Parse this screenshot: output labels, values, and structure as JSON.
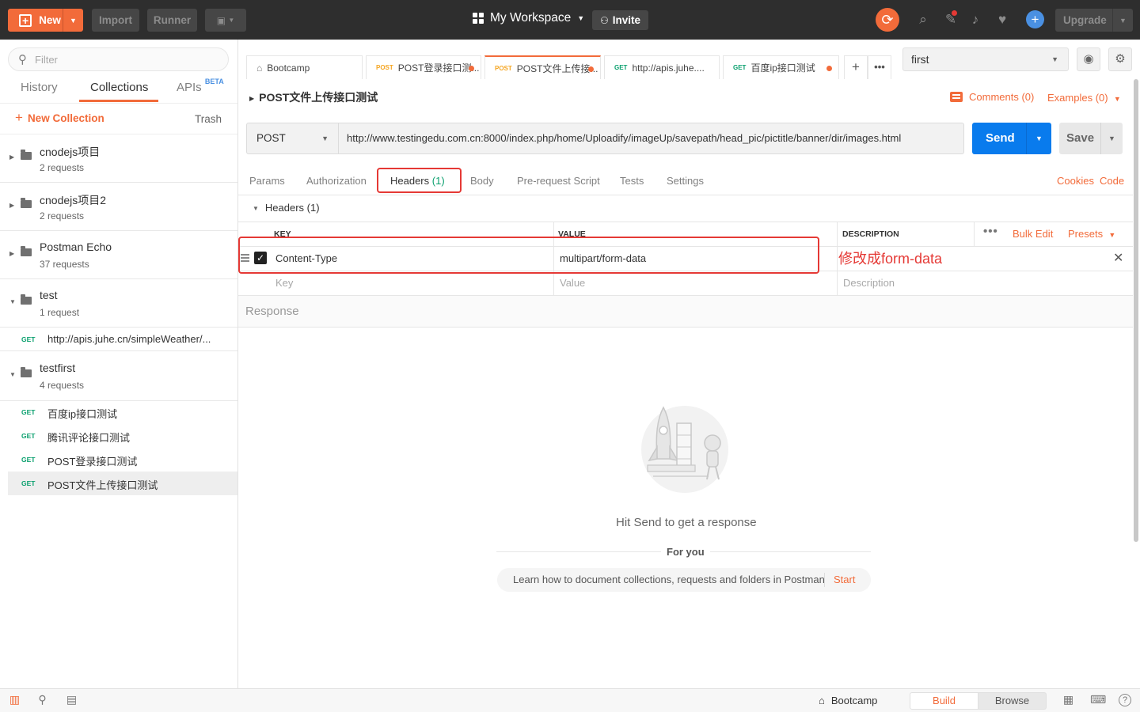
{
  "topbar": {
    "new_label": "New",
    "import_label": "Import",
    "runner_label": "Runner",
    "workspace_label": "My Workspace",
    "invite_label": "Invite",
    "upgrade_label": "Upgrade"
  },
  "sidebar": {
    "filter_placeholder": "Filter",
    "tabs": {
      "history": "History",
      "collections": "Collections",
      "apis": "APIs",
      "apis_badge": "BETA"
    },
    "new_collection": "New Collection",
    "trash": "Trash",
    "collections": [
      {
        "name": "cnodejs项目",
        "count": "2 requests"
      },
      {
        "name": "cnodejs项目2",
        "count": "2 requests"
      },
      {
        "name": "Postman Echo",
        "count": "37 requests"
      },
      {
        "name": "test",
        "count": "1 request"
      },
      {
        "name": "testfirst",
        "count": "4 requests"
      }
    ],
    "test_requests": [
      {
        "method": "GET",
        "title": "http://apis.juhe.cn/simpleWeather/..."
      }
    ],
    "testfirst_requests": [
      {
        "method": "GET",
        "title": "百度ip接口测试"
      },
      {
        "method": "GET",
        "title": "腾讯评论接口测试"
      },
      {
        "method": "GET",
        "title": "POST登录接口测试"
      },
      {
        "method": "GET",
        "title": "POST文件上传接口测试"
      }
    ]
  },
  "tabs": [
    {
      "method": "",
      "title": "Bootcamp"
    },
    {
      "method": "POST",
      "title": "POST登录接口测..."
    },
    {
      "method": "POST",
      "title": "POST文件上传接..."
    },
    {
      "method": "GET",
      "title": "http://apis.juhe...."
    },
    {
      "method": "GET",
      "title": "百度ip接口测试"
    }
  ],
  "environment": {
    "selected": "first"
  },
  "request": {
    "title": "POST文件上传接口测试",
    "comments": "Comments (0)",
    "examples": "Examples (0)",
    "method": "POST",
    "url": "http://www.testingedu.com.cn:8000/index.php/home/Uploadify/imageUp/savepath/head_pic/pictitle/banner/dir/images.html",
    "send_label": "Send",
    "save_label": "Save"
  },
  "subtabs": {
    "params": "Params",
    "authorization": "Authorization",
    "headers": "Headers",
    "headers_count": "(1)",
    "body": "Body",
    "prerequest": "Pre-request Script",
    "tests": "Tests",
    "settings": "Settings",
    "cookies": "Cookies",
    "code": "Code"
  },
  "headers_section": {
    "title": "Headers (1)",
    "columns": {
      "key": "KEY",
      "value": "VALUE",
      "description": "DESCRIPTION"
    },
    "bulk_edit": "Bulk Edit",
    "presets": "Presets",
    "rows": [
      {
        "key": "Content-Type",
        "value": "multipart/form-data",
        "checked": true
      }
    ],
    "placeholders": {
      "key": "Key",
      "value": "Value",
      "description": "Description"
    },
    "annotation": "修改成form-data"
  },
  "response": {
    "label": "Response",
    "hint": "Hit Send to get a response",
    "for_you": "For you",
    "learn_text": "Learn how to document collections, requests and folders in Postman",
    "start": "Start"
  },
  "statusbar": {
    "bootcamp": "Bootcamp",
    "build": "Build",
    "browse": "Browse"
  },
  "colors": {
    "accent": "#f26b3a",
    "send": "#097bed",
    "get_method": "#0aa06e",
    "highlight": "#e53935"
  }
}
